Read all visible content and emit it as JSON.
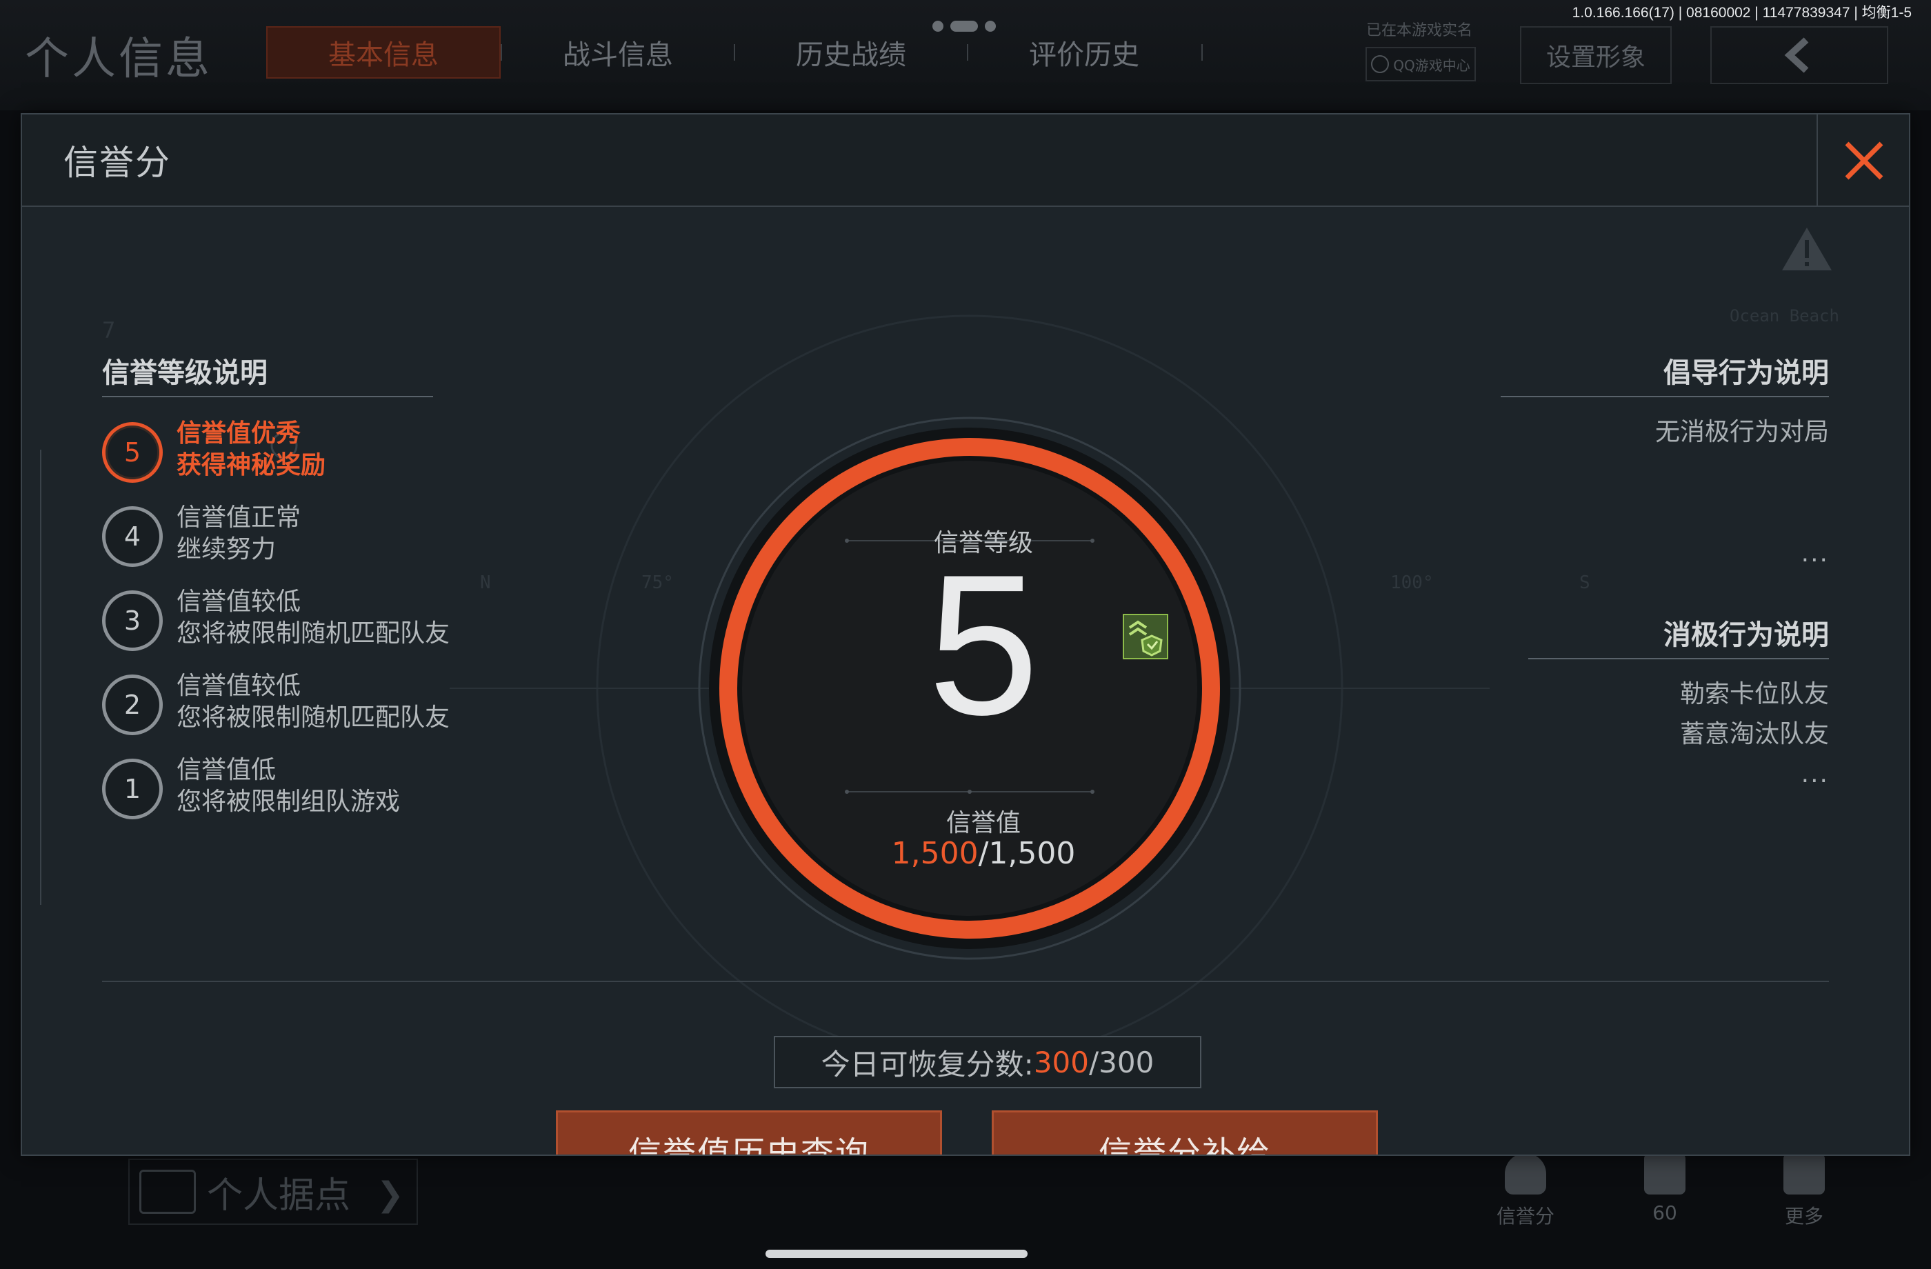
{
  "background": {
    "title": "个人信息",
    "tabs": [
      "基本信息",
      "战斗信息",
      "历史战绩",
      "评价历史"
    ],
    "realname_text": "已在本游戏实名",
    "qq_label": "QQ游戏中心",
    "set_image_label": "设置形象",
    "back_icon": "chevron-left-icon",
    "version": "1.0.166.166(17) | 08160002 | 11477839347 | 均衡1-5",
    "bottom_left_label": "个人据点",
    "bottom_icons": [
      {
        "icon": "shield-star-icon",
        "label": "信誉分"
      },
      {
        "icon": "thumbs-up-icon",
        "label": "60"
      },
      {
        "icon": "grid-icon",
        "label": "更多"
      }
    ],
    "faint_texts": [
      "7",
      "N",
      "75°",
      "100°",
      "S",
      "Ocean Beach"
    ]
  },
  "modal": {
    "title": "信誉分",
    "close_icon": "close-icon",
    "left": {
      "title": "信誉等级说明",
      "levels": [
        {
          "num": "5",
          "line1": "信誉值优秀",
          "line2": "获得神秘奖励",
          "active": true
        },
        {
          "num": "4",
          "line1": "信誉值正常",
          "line2": "继续努力",
          "active": false
        },
        {
          "num": "3",
          "line1": "信誉值较低",
          "line2": "您将被限制随机匹配队友",
          "active": false
        },
        {
          "num": "2",
          "line1": "信誉值较低",
          "line2": "您将被限制随机匹配队友",
          "active": false
        },
        {
          "num": "1",
          "line1": "信誉值低",
          "line2": "您将被限制组队游戏",
          "active": false
        }
      ]
    },
    "center": {
      "level_label": "信誉等级",
      "level": "5",
      "value_label": "信誉值",
      "value_current": "1,500",
      "value_max": "/1,500",
      "progress": 1.0,
      "badge_icon": "rank-badge-icon"
    },
    "right": {
      "positive_title": "倡导行为说明",
      "positive_items": [
        "无消极行为对局"
      ],
      "positive_more": "...",
      "negative_title": "消极行为说明",
      "negative_items": [
        "勒索卡位队友",
        "蓄意淘汰队友"
      ],
      "negative_more": "..."
    },
    "recover": {
      "label": "今日可恢复分数:",
      "current": "300",
      "max": "/300"
    },
    "buttons": {
      "history": "信誉值历史查询",
      "supplement": "信誉分补给"
    }
  },
  "colors": {
    "accent": "#ee5a2c",
    "modal_bg": "#1d2429",
    "button_bg": "#8a3a22"
  }
}
